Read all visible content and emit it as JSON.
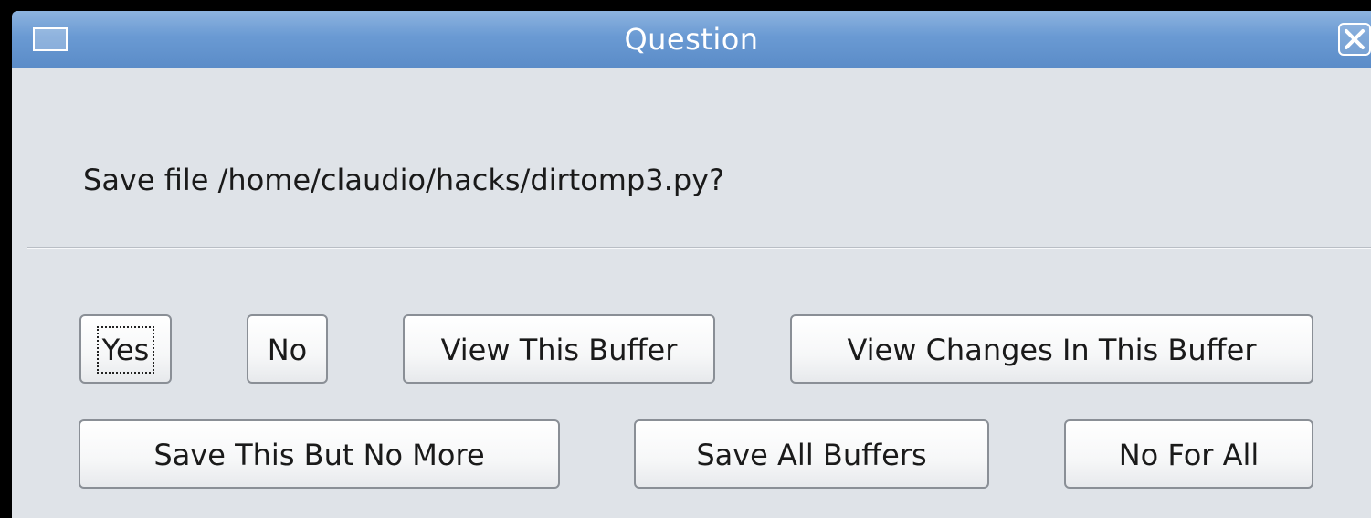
{
  "window": {
    "title": "Question",
    "menu_icon": "window-menu-icon",
    "close_icon": "close-icon"
  },
  "dialog": {
    "message": "Save file /home/claudio/hacks/dirtomp3.py?"
  },
  "buttons": {
    "yes": "Yes",
    "no": "No",
    "view_buffer": "View This Buffer",
    "view_changes": "View Changes In This Buffer",
    "save_this_no_more": "Save This But No More",
    "save_all": "Save All Buffers",
    "no_for_all": "No For All"
  },
  "colors": {
    "titlebar": "#6a9ad3",
    "dialog_bg": "#dfe3e8"
  }
}
